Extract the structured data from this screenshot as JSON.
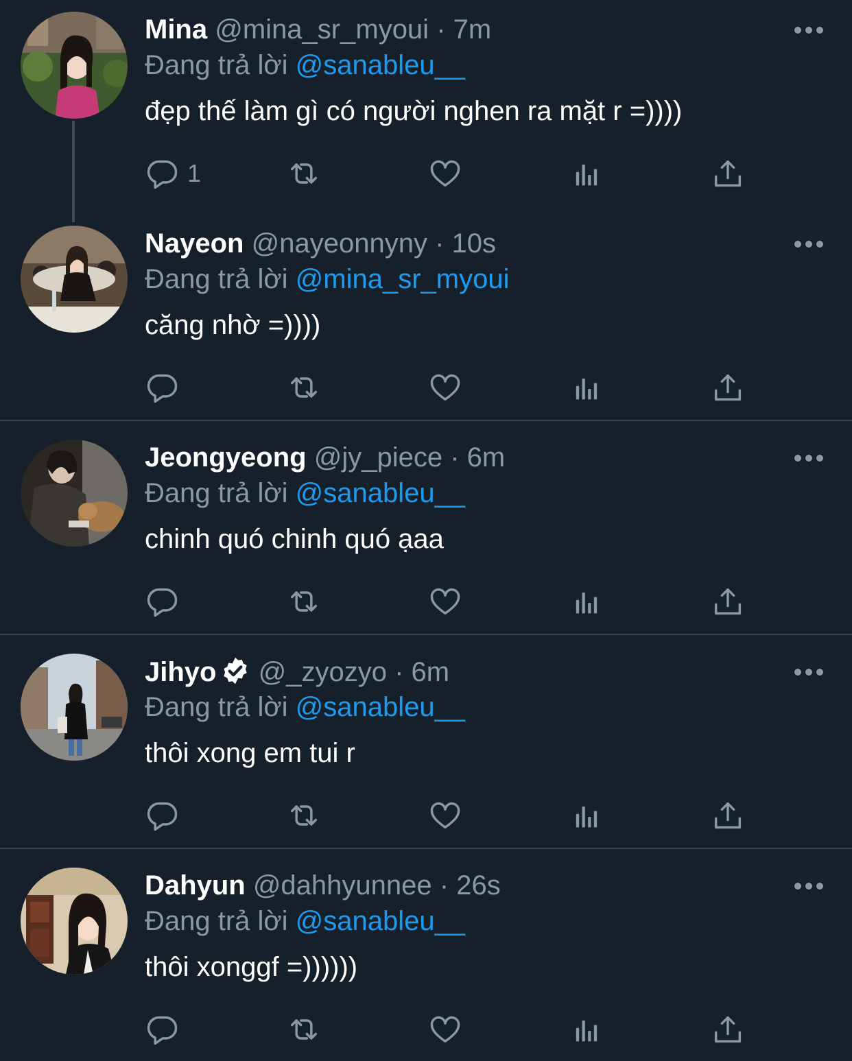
{
  "tweets": [
    {
      "name": "Mina",
      "handle": "@mina_sr_myoui",
      "time": "7m",
      "reply_prefix": "Đang trả lời",
      "reply_to": "@sanableu__",
      "text": "đẹp thế làm gì có người nghen ra mặt r =))))",
      "reply_count": "1",
      "verified": false
    },
    {
      "name": "Nayeon",
      "handle": "@nayeonnyny",
      "time": "10s",
      "reply_prefix": "Đang trả lời",
      "reply_to": "@mina_sr_myoui",
      "text": "căng nhờ =))))",
      "reply_count": "",
      "verified": false
    },
    {
      "name": "Jeongyeong",
      "handle": "@jy_piece",
      "time": "6m",
      "reply_prefix": "Đang trả lời",
      "reply_to": "@sanableu__",
      "text": "chinh quó chinh quó ạaa",
      "reply_count": "",
      "verified": false
    },
    {
      "name": "Jihyo",
      "handle": "@_zyozyo",
      "time": "6m",
      "reply_prefix": "Đang trả lời",
      "reply_to": "@sanableu__",
      "text": "thôi xong em tui r",
      "reply_count": "",
      "verified": true
    },
    {
      "name": "Dahyun",
      "handle": "@dahhyunnee",
      "time": "26s",
      "reply_prefix": "Đang trả lời",
      "reply_to": "@sanableu__",
      "text": "thôi xonggf =))))))",
      "reply_count": "",
      "verified": false
    }
  ],
  "separator": "·",
  "icons": [
    "reply-icon",
    "retweet-icon",
    "like-icon",
    "analytics-icon",
    "share-icon",
    "more-icon",
    "verified-icon"
  ],
  "colors": {
    "background": "#15202b",
    "secondary_text": "#8899a6",
    "mention": "#1d9bf0",
    "divider": "#38444d"
  }
}
